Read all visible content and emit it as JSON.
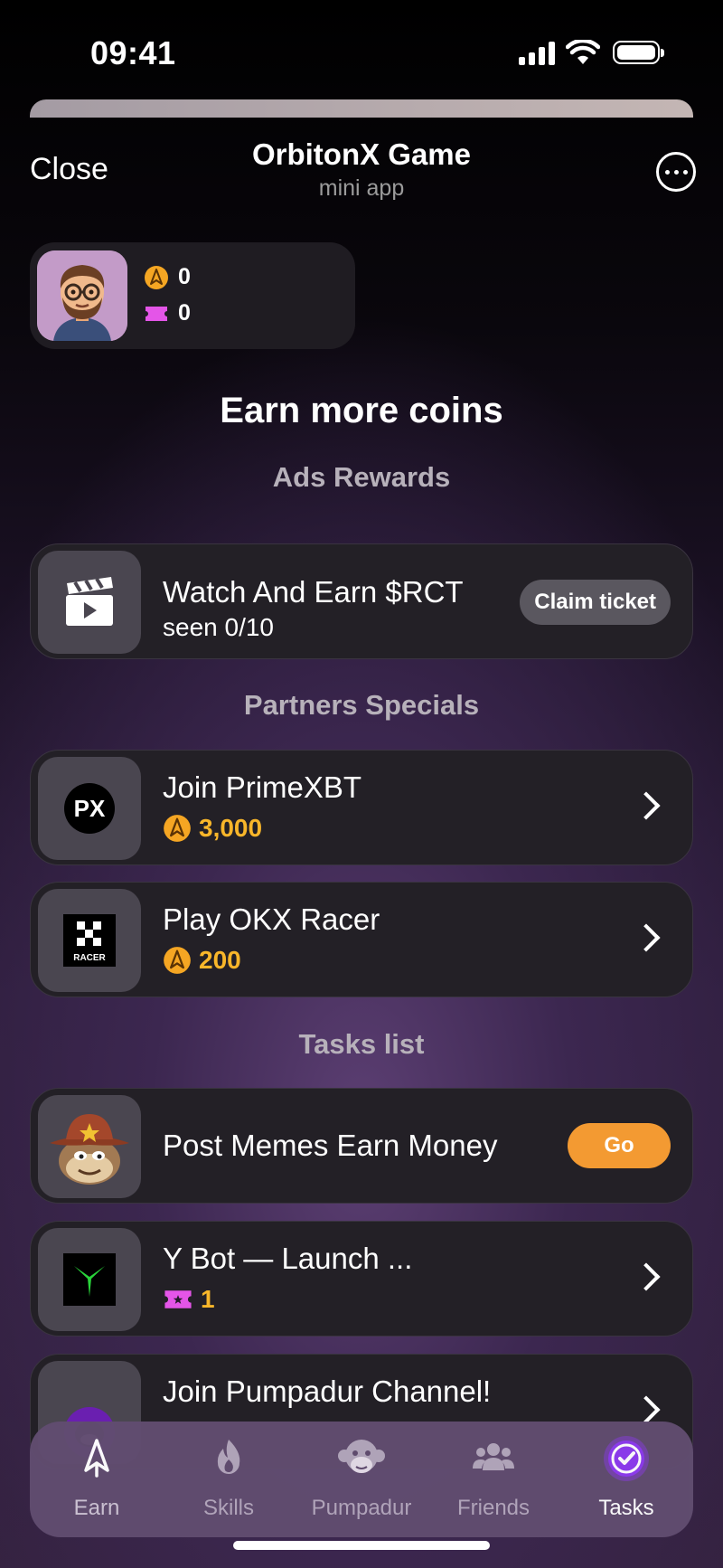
{
  "status": {
    "time": "09:41"
  },
  "header": {
    "close": "Close",
    "title": "OrbitonX Game",
    "subtitle": "mini app"
  },
  "profile": {
    "coins": "0",
    "tickets": "0"
  },
  "headline": "Earn more coins",
  "ads": {
    "section": "Ads Rewards",
    "item": {
      "title": "Watch And Earn $RCT",
      "sub": "seen 0/10",
      "button": "Claim ticket"
    }
  },
  "partners": {
    "section": "Partners Specials",
    "items": [
      {
        "title": "Join PrimeXBT",
        "reward": "3,000",
        "logo": "PX"
      },
      {
        "title": "Play OKX Racer",
        "reward": "200",
        "logo": "RACER"
      }
    ]
  },
  "tasks": {
    "section": "Tasks list",
    "items": [
      {
        "title": "Post Memes Earn Money",
        "button": "Go"
      },
      {
        "title": "Y Bot — Launch ...",
        "reward": "1"
      },
      {
        "title": "Join Pumpadur Channel!"
      }
    ]
  },
  "tabs": [
    {
      "label": "Earn",
      "icon": "rocket-icon"
    },
    {
      "label": "Skills",
      "icon": "flame-icon"
    },
    {
      "label": "Pumpadur",
      "icon": "monkey-icon"
    },
    {
      "label": "Friends",
      "icon": "friends-icon"
    },
    {
      "label": "Tasks",
      "icon": "check-icon",
      "active": true
    }
  ],
  "colors": {
    "accent_orange": "#f39a32",
    "coin_gold": "#f8b62a",
    "ticket_pink": "#e455e8",
    "tasks_active": "#8e3bf0"
  }
}
